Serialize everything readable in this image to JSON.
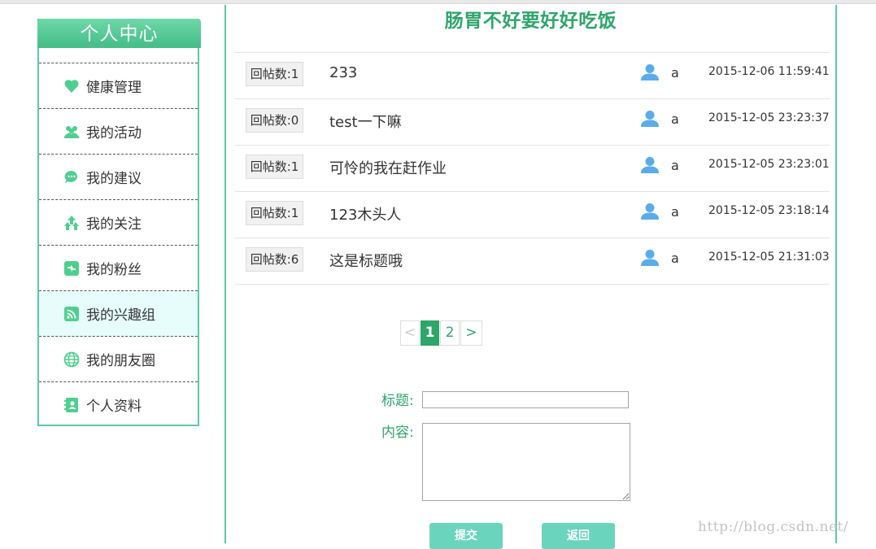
{
  "sidebar": {
    "title": "个人中心",
    "items": [
      {
        "label": "健康管理",
        "icon": "heart-icon"
      },
      {
        "label": "我的活动",
        "icon": "people-icon"
      },
      {
        "label": "我的建议",
        "icon": "chat-bubble-icon"
      },
      {
        "label": "我的关注",
        "icon": "follow-arrows-icon"
      },
      {
        "label": "我的粉丝",
        "icon": "fans-icon"
      },
      {
        "label": "我的兴趣组",
        "icon": "rss-icon",
        "active": true
      },
      {
        "label": "我的朋友圈",
        "icon": "globe-icon"
      },
      {
        "label": "个人资料",
        "icon": "profile-card-icon"
      }
    ]
  },
  "main": {
    "title": "肠胃不好要好好吃饭"
  },
  "posts": [
    {
      "replies": "回帖数:1",
      "title": "233",
      "user": "a",
      "time": "2015-12-06 11:59:41"
    },
    {
      "replies": "回帖数:0",
      "title": "test一下嘛",
      "user": "a",
      "time": "2015-12-05 23:23:37"
    },
    {
      "replies": "回帖数:1",
      "title": "可怜的我在赶作业",
      "user": "a",
      "time": "2015-12-05 23:23:01"
    },
    {
      "replies": "回帖数:1",
      "title": "123木头人",
      "user": "a",
      "time": "2015-12-05 23:18:14"
    },
    {
      "replies": "回帖数:6",
      "title": "这是标题哦",
      "user": "a",
      "time": "2015-12-05 21:31:03"
    }
  ],
  "pagination": {
    "prev": "<",
    "pages": [
      "1",
      "2"
    ],
    "current": "1",
    "next": ">"
  },
  "form": {
    "title_label": "标题:",
    "content_label": "内容:",
    "title_value": "",
    "content_value": "",
    "submit_label": "提交",
    "back_label": "返回"
  },
  "watermark": "http://blog.csdn.net/",
  "colors": {
    "accent": "#2ea56a",
    "border": "#5cc9a0",
    "button": "#6bd4bd",
    "icon_green": "#4fcf8f",
    "icon_blue": "#5aace8"
  }
}
